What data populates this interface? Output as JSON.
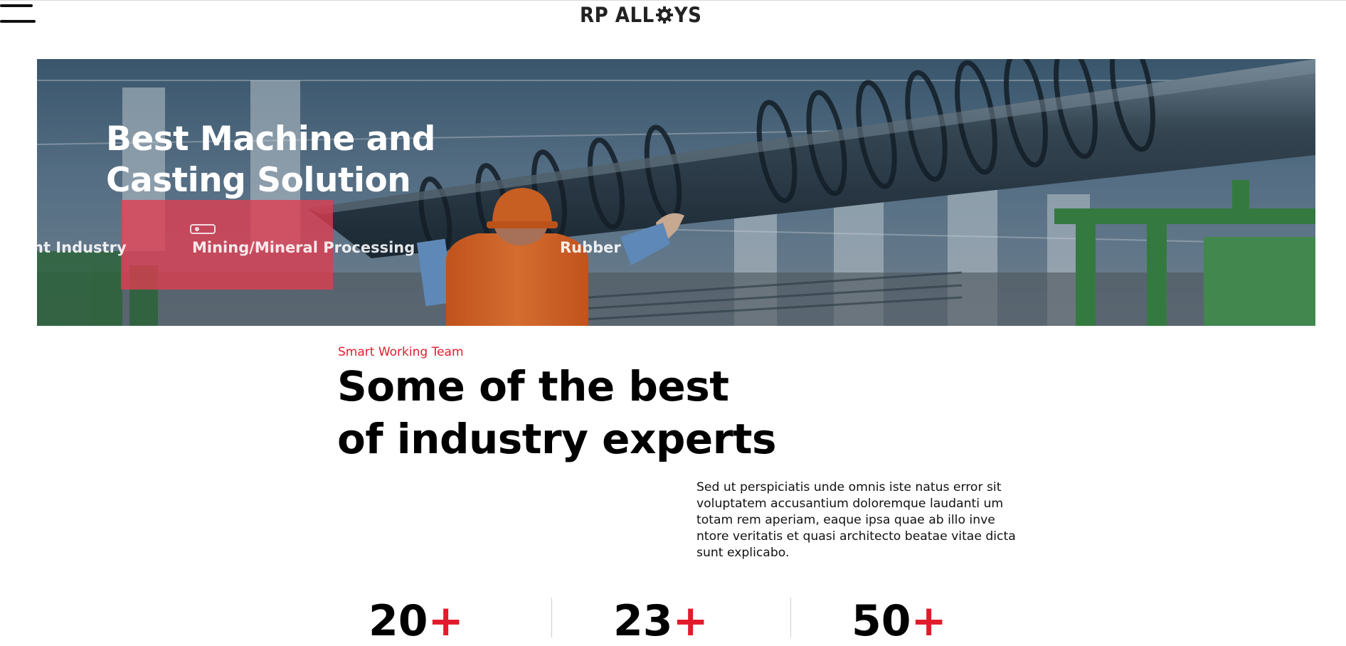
{
  "header": {
    "logo_left": "RP ALL",
    "logo_right": "YS",
    "menu_icon": "hamburger-menu-icon"
  },
  "hero": {
    "title": "Best Machine and Casting Solution",
    "ticker_items": [
      "nt Industry",
      "Mining/Mineral Processing",
      "Rubber"
    ]
  },
  "section": {
    "eyebrow": "Smart Working Team",
    "heading": "Some of the best of industry experts",
    "body": "Sed ut perspiciatis unde omnis iste natus error sit voluptatem accusantium doloremque laudanti um totam rem aperiam, eaque ipsa quae ab illo inve ntore veritatis et quasi architecto beatae vitae dicta sunt explicabo."
  },
  "stats": [
    {
      "value": "20",
      "suffix": "+"
    },
    {
      "value": "23",
      "suffix": "+"
    },
    {
      "value": "50",
      "suffix": "+"
    }
  ],
  "colors": {
    "accent": "#e21b2c",
    "hero_overlay": "#2c4b63",
    "vest": "#f36a1c",
    "machinery": "#3c8a3f"
  }
}
